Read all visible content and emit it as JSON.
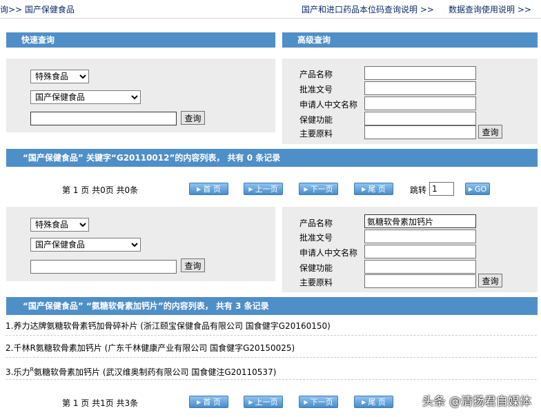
{
  "topbar": {
    "breadcrumb": "询>> 国产保健食品",
    "link1": "国产和进口药品本位码查询说明 >>",
    "link2": "数据查询使用说明 >>"
  },
  "quick": {
    "title": "快速查询"
  },
  "advanced": {
    "title": "高级查询",
    "labels": [
      "产品名称",
      "批准文号",
      "申请人中文名称",
      "保健功能",
      "主要原料"
    ]
  },
  "form1": {
    "category": "特殊食品",
    "subcategory": "国产保健食品",
    "keyword": "",
    "query_button": "查询",
    "adv_values": [
      "",
      "",
      "",
      "",
      ""
    ],
    "adv_query_button": "查询"
  },
  "result1": {
    "header": "“国产保健食品” 关键字“G20110012”的内容列表，  共有 0 条记录",
    "pager_info": "第 1 页 共0页 共0条"
  },
  "pager": {
    "first": "首 页",
    "prev": "上一页",
    "next": "下一页",
    "last": "尾 页",
    "jump_label": "跳转",
    "jump_value": "1",
    "go": "GO"
  },
  "form2": {
    "category": "特殊食品",
    "subcategory": "国产保健食品",
    "keyword": "",
    "query_button": "查询",
    "adv_values": [
      "氨糖软骨素加钙片",
      "",
      "",
      "",
      ""
    ],
    "adv_query_button": "查询"
  },
  "result2": {
    "header": "“国产保健食品” “氨糖软骨素加钙片”的内容列表，  共有 3 条记录",
    "items": [
      "1.养力达牌氨糖软骨素钙加骨碎补片 (浙江颐宝保健食品有限公司 国食健字G20160150)",
      "2.千林R氨糖软骨素加钙片 (广东千林健康产业有限公司 国食健字G20150025)",
      "3.乐力",
      "R",
      "氨糖软骨素加钙片 (武汉维奥制药有限公司 国食健注G20110537)"
    ],
    "pager_info": "第 1 页 共1页 共3条"
  },
  "watermark": "头条 @清扬君自媒体"
}
